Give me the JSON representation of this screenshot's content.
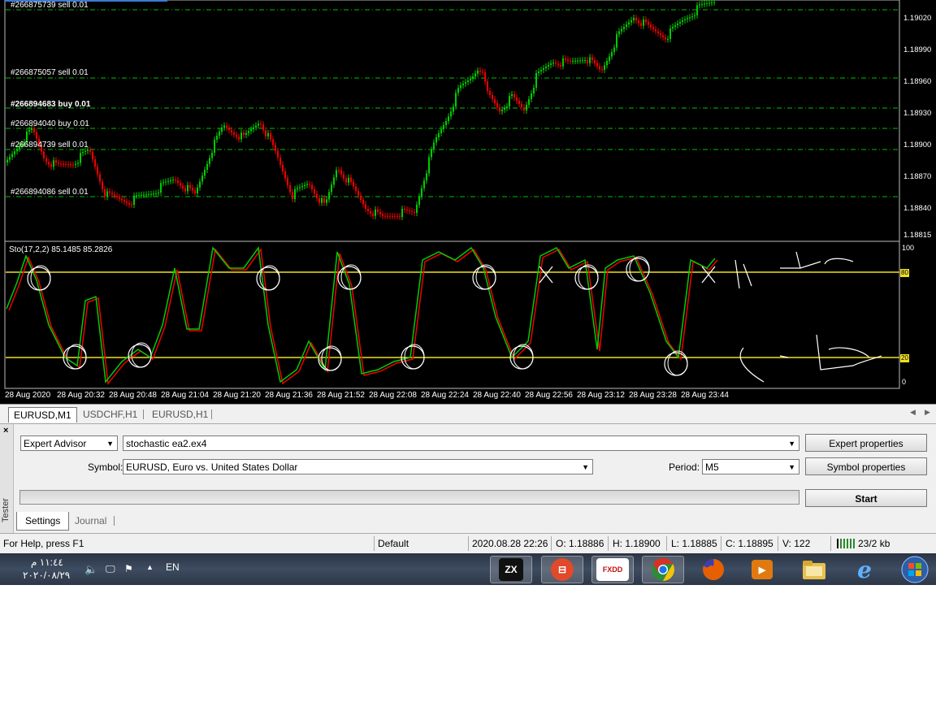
{
  "colors": {
    "bull": "#00cc00",
    "bear": "#ee0000",
    "level_line": "#f0e020",
    "order_line": "#00c000",
    "background": "#000000"
  },
  "orders": [
    {
      "label": "#266875739 sell 0.01",
      "bold": false
    },
    {
      "label": "#266875057 sell 0.01",
      "bold": false
    },
    {
      "label": "#266894683 buy 0.01",
      "bold": true
    },
    {
      "label": "#266894040 buy 0.01",
      "bold": false
    },
    {
      "label": "#266894739 sell 0.01",
      "bold": false
    },
    {
      "label": "#266894086 sell 0.01",
      "bold": false
    }
  ],
  "price_scale": [
    "1.19020",
    "1.18990",
    "1.18960",
    "1.18930",
    "1.18900",
    "1.18870",
    "1.18840",
    "1.18815"
  ],
  "stochastic": {
    "header": "Sto(17,2,2) 85.1485 85.2826",
    "scale_top": "100",
    "scale_bottom": "0",
    "level_high": "80",
    "level_low": "20"
  },
  "time_axis": [
    "28 Aug 2020",
    "28 Aug 20:32",
    "28 Aug 20:48",
    "28 Aug 21:04",
    "28 Aug 21:20",
    "28 Aug 21:36",
    "28 Aug 21:52",
    "28 Aug 22:08",
    "28 Aug 22:24",
    "28 Aug 22:40",
    "28 Aug 22:56",
    "28 Aug 23:12",
    "28 Aug 23:28",
    "28 Aug 23:44"
  ],
  "chart_tabs": [
    "EURUSD,M1",
    "USDCHF,H1",
    "EURUSD,H1"
  ],
  "tester": {
    "title": "Tester",
    "close": "×",
    "type": "Expert Advisor",
    "expert": "stochastic ea2.ex4",
    "symbol_label": "Symbol:",
    "symbol": "EURUSD, Euro vs. United States Dollar",
    "period_label": "Period:",
    "period": "M5",
    "expert_properties": "Expert properties",
    "symbol_properties": "Symbol properties",
    "start": "Start",
    "tabs": [
      "Settings",
      "Journal"
    ]
  },
  "status": {
    "help": "For Help, press F1",
    "profile": "Default",
    "datetime": "2020.08.28 22:26",
    "open": "O: 1.18886",
    "high": "H: 1.18900",
    "low": "L: 1.18885",
    "close": "C: 1.18895",
    "volume": "V: 122",
    "traffic": "23/2 kb"
  },
  "taskbar": {
    "time": "١١:٤٤ م",
    "date": "٢٠٢٠/٠٨/٢٩",
    "lang": "EN",
    "apps": [
      {
        "name": "zx-app-icon",
        "glyph": "ZX",
        "color": "#111111"
      },
      {
        "name": "anydesk-like-icon",
        "glyph": "⊟",
        "color": "#e04a2a"
      },
      {
        "name": "fxdd-icon",
        "glyph": "FXDD",
        "color": "#c01010"
      },
      {
        "name": "chrome-icon",
        "glyph": "",
        "color": "#2e8b3a"
      },
      {
        "name": "firefox-icon",
        "glyph": "",
        "color": "#e66000"
      },
      {
        "name": "media-player-icon",
        "glyph": "▶",
        "color": "#e07a10"
      },
      {
        "name": "explorer-folder-icon",
        "glyph": "",
        "color": "#e8c050"
      },
      {
        "name": "internet-explorer-icon",
        "glyph": "e",
        "color": "#1e6fd0"
      }
    ]
  }
}
